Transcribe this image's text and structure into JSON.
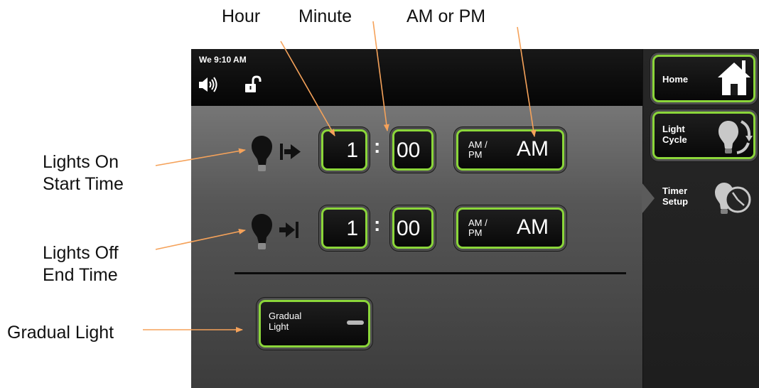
{
  "callouts": {
    "hour": "Hour",
    "minute": "Minute",
    "am_pm": "AM or PM",
    "lights_on": [
      "Lights On",
      "Start Time"
    ],
    "lights_off": [
      "Lights Off",
      "End Time"
    ],
    "gradual": "Gradual Light"
  },
  "status_bar": {
    "clock": "We 9:10 AM",
    "icons": [
      "speaker-icon",
      "unlocked-padlock-icon"
    ]
  },
  "timer": {
    "on_row": {
      "icon": "light-on-arrow-icon",
      "hour": "1",
      "separator": ":",
      "minute": "00",
      "ampm_label": [
        "AM /",
        "PM"
      ],
      "ampm_value": "AM"
    },
    "off_row": {
      "icon": "light-off-arrow-icon",
      "hour": "1",
      "separator": ":",
      "minute": "00",
      "ampm_label": [
        "AM /",
        "PM"
      ],
      "ampm_value": "AM"
    }
  },
  "gradual_light": {
    "label": [
      "Gradual",
      "Light"
    ],
    "state": "off"
  },
  "sidebar": {
    "items": [
      {
        "label": [
          "Home"
        ],
        "icon": "house-icon",
        "selected": false
      },
      {
        "label": [
          "Light",
          "Cycle"
        ],
        "icon": "light-cycle-icon",
        "selected": false
      },
      {
        "label": [
          "Timer",
          "Setup"
        ],
        "icon": "timer-clock-icon",
        "selected": true
      }
    ]
  },
  "colors": {
    "button_border": "#8bd63a",
    "arrow": "#f5a25a",
    "screen_dark": "#0a0a0a",
    "panel": "#5a5a5a"
  }
}
